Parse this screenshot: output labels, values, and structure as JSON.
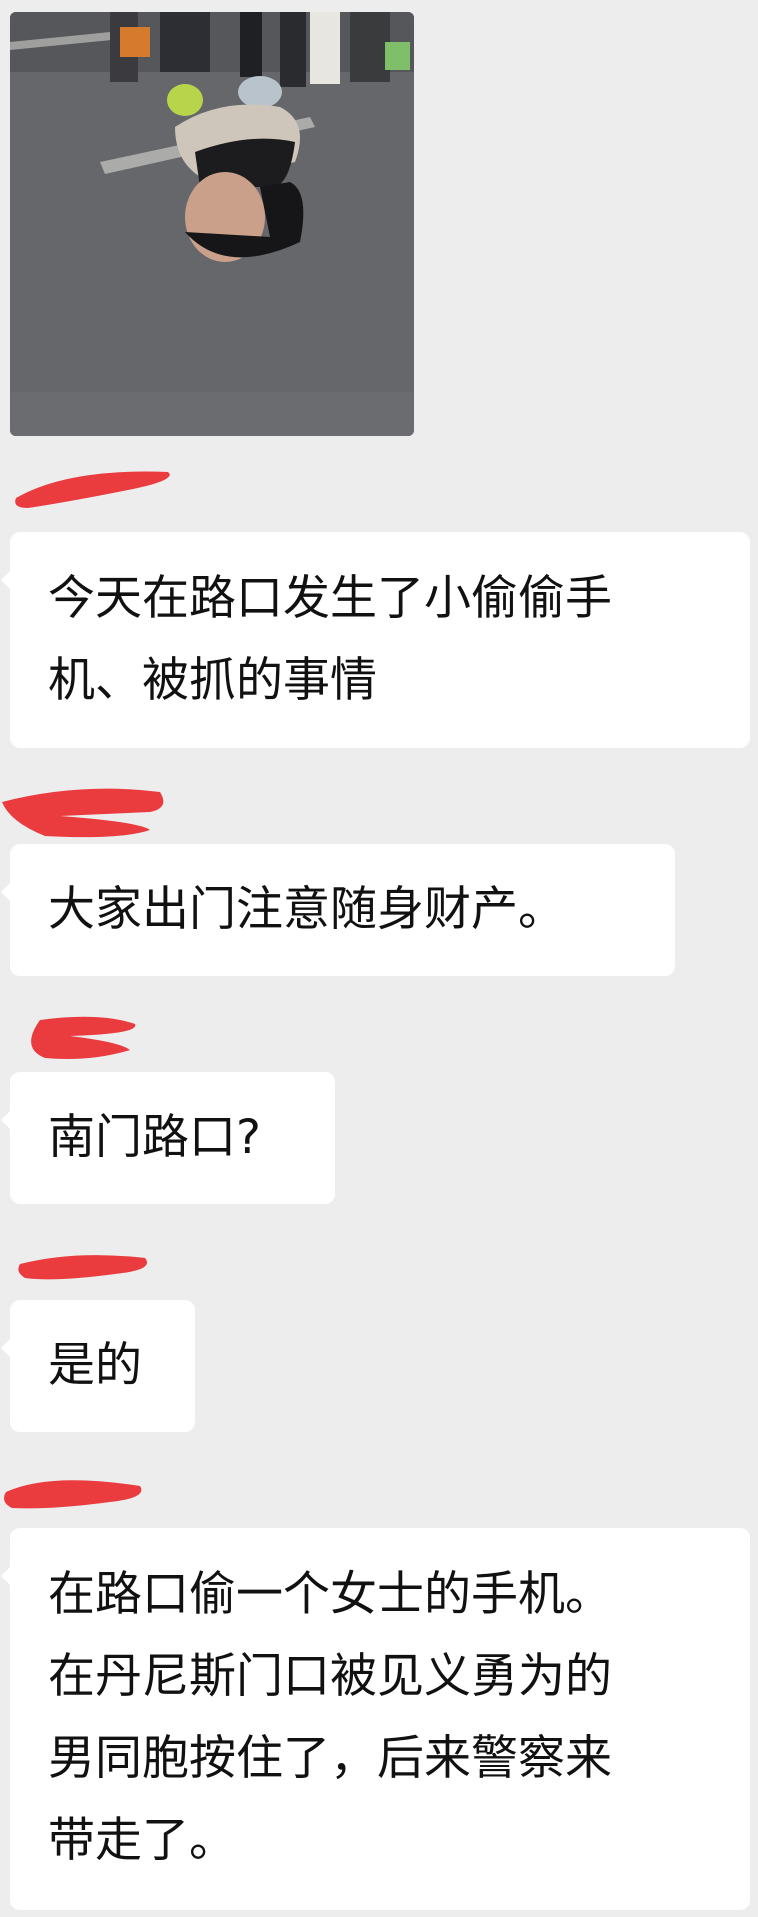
{
  "chat": {
    "image": {
      "alt": "street scene photo",
      "icon": "photo-attachment"
    },
    "messages": [
      {
        "lines": [
          "今天在路口发生了小偷偷手",
          "机、被抓的事情"
        ]
      },
      {
        "lines": [
          "大家出门注意随身财产。"
        ]
      },
      {
        "lines": [
          "南门路口?"
        ]
      },
      {
        "lines": [
          "是的"
        ]
      },
      {
        "lines": [
          "在路口偷一个女士的手机。",
          "在丹尼斯门口被见义勇为的",
          "男同胞按住了，后来警察来",
          "带走了。"
        ]
      }
    ],
    "redaction_color": "#ea3b3f",
    "bubble_color": "#ffffff",
    "background_color": "#ededed"
  }
}
